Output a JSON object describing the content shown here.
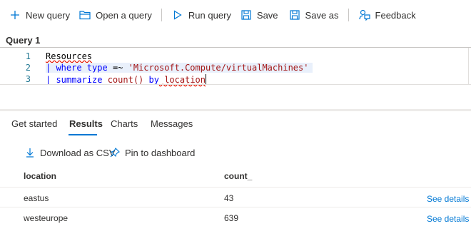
{
  "toolbar": {
    "new_query": "New query",
    "open_query": "Open a query",
    "run_query": "Run query",
    "save": "Save",
    "save_as": "Save as",
    "feedback": "Feedback"
  },
  "query_tab": "Query 1",
  "editor": {
    "line_numbers": [
      "1",
      "2",
      "3"
    ],
    "lines": {
      "l1": "Resources",
      "l2_pipe": "| ",
      "l2_where": "where",
      "l2_type": " type ",
      "l2_op": "=~",
      "l2_str": " 'Microsoft.Compute/virtualMachines'",
      "l3_pipe": "| ",
      "l3_summ": "summarize",
      "l3_count": " count()",
      "l3_by": " by",
      "l3_loc": " location"
    }
  },
  "results_tabs": [
    "Get started",
    "Results",
    "Charts",
    "Messages"
  ],
  "active_tab": "Results",
  "actions": {
    "download": "Download as CSV",
    "pin": "Pin to dashboard"
  },
  "grid": {
    "columns": [
      "location",
      "count_"
    ],
    "rows": [
      {
        "location": "eastus",
        "count": "43",
        "link": "See details"
      },
      {
        "location": "westeurope",
        "count": "639",
        "link": "See details"
      }
    ]
  },
  "colors": {
    "accent": "#0078d4",
    "keyword": "#0000ff",
    "string": "#a31515"
  }
}
